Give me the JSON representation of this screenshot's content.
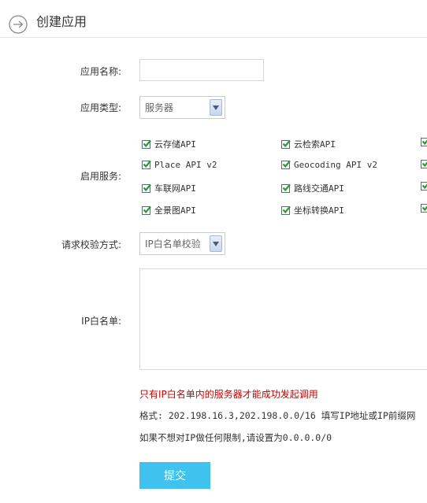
{
  "header": {
    "title": "创建应用",
    "icon": "back-arrow-icon"
  },
  "form": {
    "app_name_label": "应用名称:",
    "app_name_value": "",
    "app_type_label": "应用类型:",
    "app_type_value": "服务器",
    "services_label": "启用服务:",
    "services": [
      {
        "label": "云存储API",
        "checked": true
      },
      {
        "label": "云检索API",
        "checked": true
      },
      {
        "label": "",
        "checked": true
      },
      {
        "label": "Place API v2",
        "checked": true
      },
      {
        "label": "Geocoding API v2",
        "checked": true
      },
      {
        "label": "",
        "checked": true
      },
      {
        "label": "车联网API",
        "checked": true
      },
      {
        "label": "路线交通API",
        "checked": true
      },
      {
        "label": "",
        "checked": true
      },
      {
        "label": "全景图API",
        "checked": true
      },
      {
        "label": "坐标转换API",
        "checked": true
      },
      {
        "label": "",
        "checked": true
      }
    ],
    "verify_label": "请求校验方式:",
    "verify_value": "IP白名单校验",
    "whitelist_label": "IP白名单:",
    "whitelist_value": "",
    "warning": "只有IP白名单内的服务器才能成功发起调用",
    "format_hint": "格式: 202.198.16.3,202.198.0.0/16 填写IP地址或IP前缀网",
    "no_limit_hint": "如果不想对IP做任何限制,请设置为0.0.0.0/0",
    "submit_label": "提交"
  },
  "colors": {
    "accent": "#3fc2ee",
    "warning": "#cc0000",
    "check": "#2e9a2e"
  }
}
